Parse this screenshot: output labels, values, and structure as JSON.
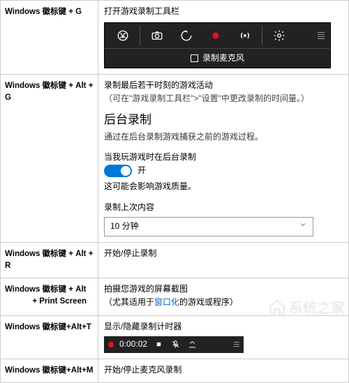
{
  "rows": {
    "r1": {
      "label": "Windows 徽标键 + G",
      "title": "打开游戏录制工具栏",
      "checkbox_label": "录制麦克风"
    },
    "r2": {
      "label": "Windows 徽标键 + Alt + G",
      "line1": "录制最后若干时刻的游戏活动",
      "line2": "（可在\"游戏录制工具栏\">\"设置\"中更改录制的时间量。）",
      "heading": "后台录制",
      "desc": "通过在后台录制游戏捕获之前的游戏过程。",
      "toggle_label": "当我玩游戏时在后台录制",
      "toggle_state": "开",
      "warning": "这可能会影响游戏质量。",
      "field_label": "录制上次内容",
      "select_value": "10 分钟"
    },
    "r3": {
      "label": "Windows 徽标键 + Alt + R",
      "text": "开始/停止录制"
    },
    "r4": {
      "label_a": "Windows 徽标键 + Alt",
      "label_b": "+ Print Screen",
      "line1": "拍摄您游戏的屏幕截图",
      "line2a": "（尤其适用于",
      "line2b": "窗口化",
      "line2c": "的游戏或程序）"
    },
    "r5": {
      "label": "Windows 徽标键+Alt+T",
      "text": "显示/隐藏录制计时器",
      "timer": "0:00:02"
    },
    "r6": {
      "label": "Windows 徽标键+Alt+M",
      "text": "开始/停止麦克风录制"
    }
  },
  "watermark": "系统之家"
}
